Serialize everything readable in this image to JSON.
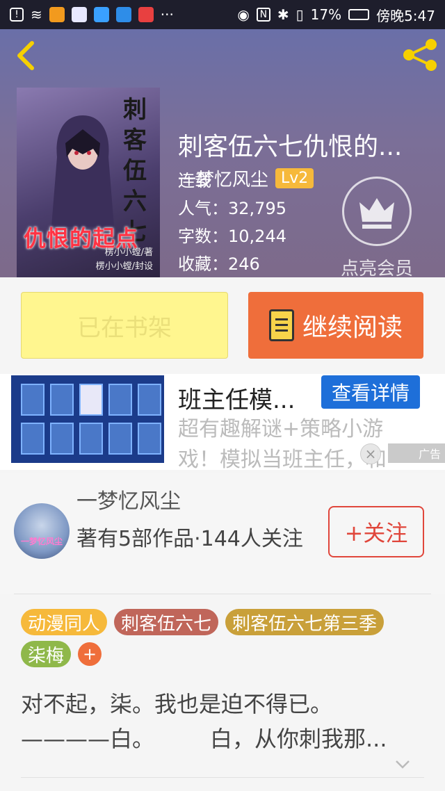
{
  "status_bar": {
    "battery": "17%",
    "time": "傍晚5:47",
    "more": "···"
  },
  "book": {
    "title": "刺客伍六七仇恨的...",
    "author": "一梦忆风尘",
    "author_level": "Lv2",
    "status": "连载",
    "popularity_label": "人气：",
    "popularity": "32,795",
    "words_label": "字数：",
    "words": "10,244",
    "favorites_label": "收藏：",
    "favorites": "246",
    "cover": {
      "title_vertical": [
        "刺",
        "客",
        "伍",
        "六",
        "七"
      ],
      "subtitle": "仇恨的起点",
      "credit_author": "楞小小螳/著",
      "credit_cover": "楞小小螳/封设"
    }
  },
  "vip": {
    "label": "点亮会员"
  },
  "actions": {
    "shelf_label": "已在书架",
    "read_label": "继续阅读"
  },
  "ad": {
    "title": "班主任模...",
    "detail_button": "查看详情",
    "description": "超有趣解谜+策略小游戏！模拟当班主任，和",
    "tag": "广告",
    "close": "×"
  },
  "author_section": {
    "name": "一梦忆风尘",
    "info": "著有5部作品·144人关注",
    "follow_button": "+关注",
    "avatar_text": "一梦忆风尘"
  },
  "tags": [
    {
      "label": "动漫同人",
      "color": "#f6b93b"
    },
    {
      "label": "刺客伍六七",
      "color": "#c0665a"
    },
    {
      "label": "刺客伍六七第三季",
      "color": "#c9a03a"
    },
    {
      "label": "柒梅",
      "color": "#8fb84a"
    }
  ],
  "tag_add": "+",
  "synopsis": {
    "line1": "对不起，柒。我也是迫不得已。",
    "line2": "————白。　　　白，从你刺我那..."
  },
  "colors": {
    "accent_orange": "#ef6e3b",
    "shelf_yellow": "#fff68f",
    "follow_red": "#e0463b",
    "ad_blue": "#1e6fd9"
  }
}
